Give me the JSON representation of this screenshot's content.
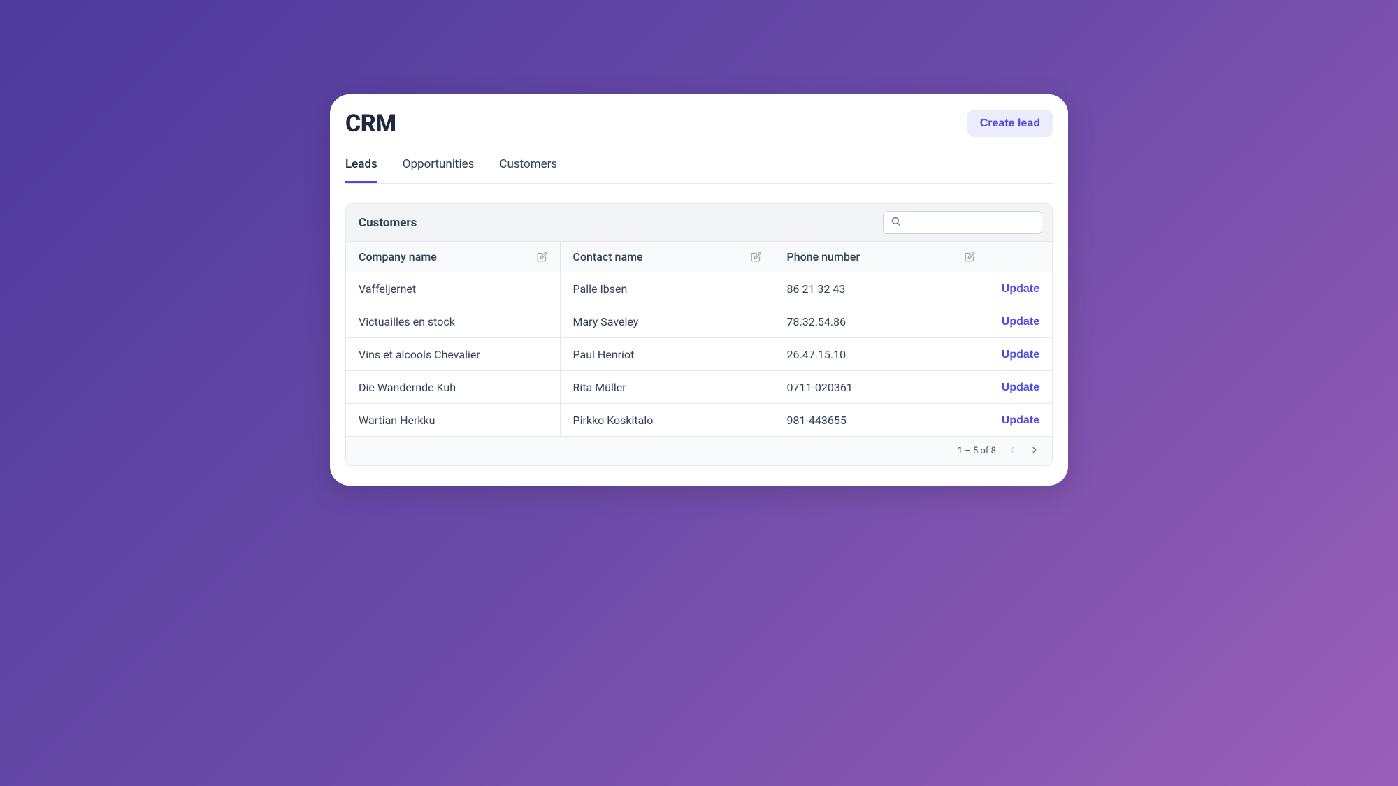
{
  "header": {
    "title": "CRM",
    "create_label": "Create lead"
  },
  "tabs": [
    {
      "label": "Leads",
      "active": true
    },
    {
      "label": "Opportunities",
      "active": false
    },
    {
      "label": "Customers",
      "active": false
    }
  ],
  "table": {
    "title": "Customers",
    "search_placeholder": "",
    "columns": [
      {
        "label": "Company name"
      },
      {
        "label": "Contact name"
      },
      {
        "label": "Phone number"
      }
    ],
    "action_label": "Update",
    "rows": [
      {
        "company": "Vaffeljernet",
        "contact": "Palle Ibsen",
        "phone": "86 21 32 43"
      },
      {
        "company": "Victuailles en stock",
        "contact": "Mary Saveley",
        "phone": "78.32.54.86"
      },
      {
        "company": "Vins et alcools Chevalier",
        "contact": "Paul Henriot",
        "phone": "26.47.15.10"
      },
      {
        "company": "Die Wandernde Kuh",
        "contact": "Rita Müller",
        "phone": "0711-020361"
      },
      {
        "company": "Wartian Herkku",
        "contact": "Pirkko Koskitalo",
        "phone": "981-443655"
      }
    ],
    "pagination": {
      "text": "1 – 5 of 8"
    }
  }
}
